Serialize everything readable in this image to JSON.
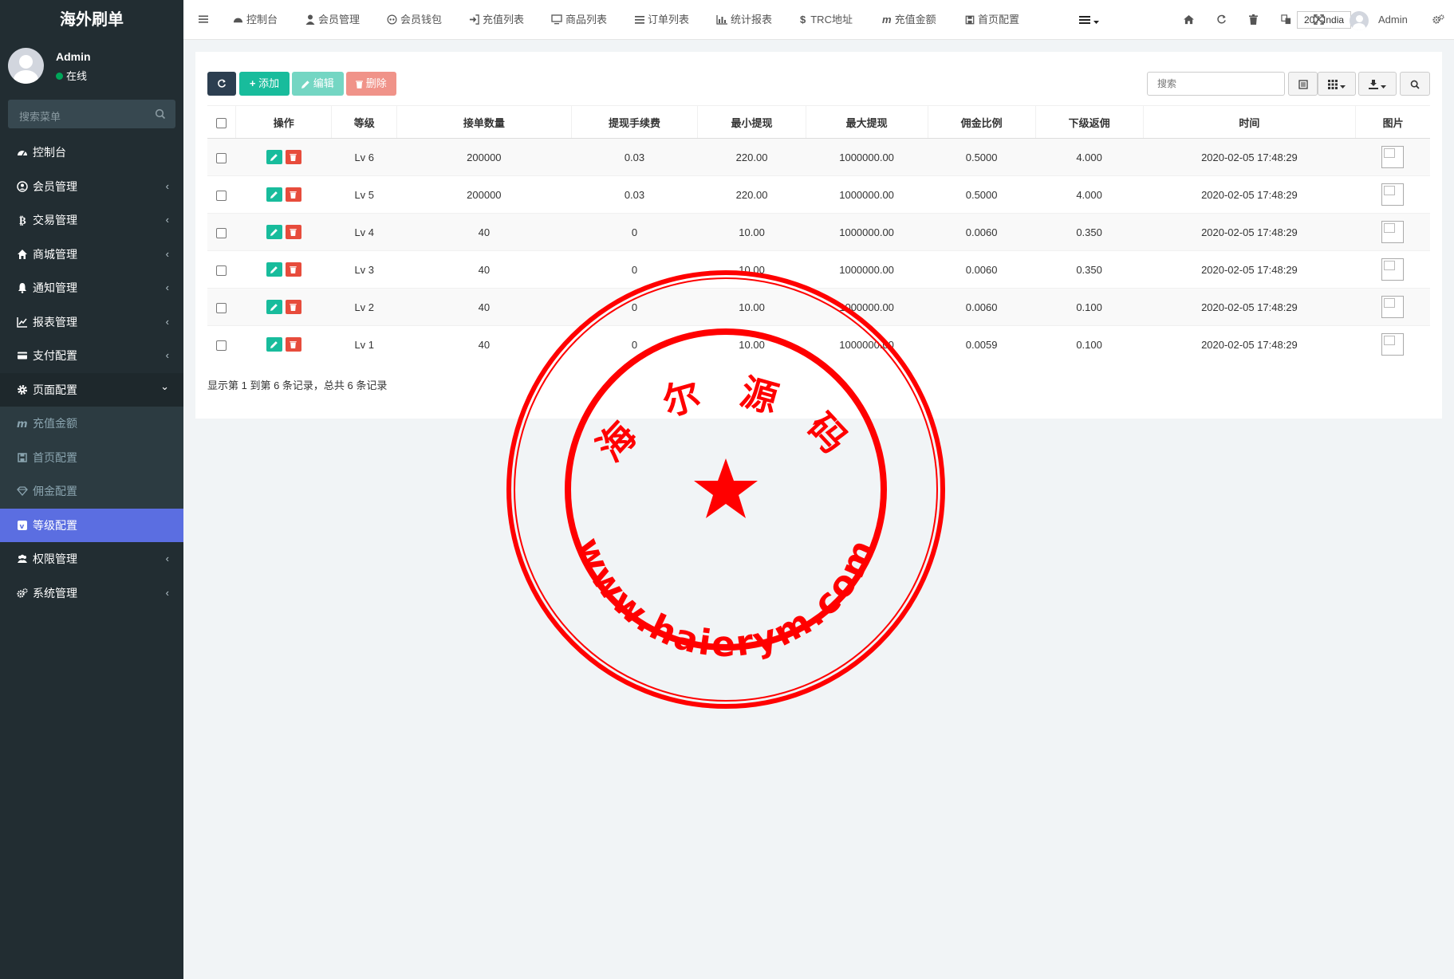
{
  "sidebar": {
    "logo": "海外刷单",
    "user": {
      "name": "Admin",
      "status": "在线"
    },
    "search_placeholder": "搜索菜单",
    "items": [
      {
        "label": "控制台",
        "icon": "dashboard-icon"
      },
      {
        "label": "会员管理",
        "icon": "user-circle-icon"
      },
      {
        "label": "交易管理",
        "icon": "bitcoin-icon"
      },
      {
        "label": "商城管理",
        "icon": "home-icon"
      },
      {
        "label": "通知管理",
        "icon": "bell-icon"
      },
      {
        "label": "报表管理",
        "icon": "line-chart-icon"
      },
      {
        "label": "支付配置",
        "icon": "credit-card-icon"
      },
      {
        "label": "页面配置",
        "icon": "gear-icon"
      }
    ],
    "subitems": [
      {
        "label": "充值金额",
        "icon": "m-icon"
      },
      {
        "label": "首页配置",
        "icon": "save-icon"
      },
      {
        "label": "佣金配置",
        "icon": "diamond-icon"
      },
      {
        "label": "等级配置",
        "icon": "vimeo-icon"
      }
    ],
    "items_after": [
      {
        "label": "权限管理",
        "icon": "users-icon"
      },
      {
        "label": "系统管理",
        "icon": "cogs-icon"
      }
    ],
    "chevron_left": "‹",
    "chevron_down": "⌄"
  },
  "topbar": {
    "nav": [
      "控制台",
      "会员管理",
      "会员钱包",
      "充值列表",
      "商品列表",
      "订单列表",
      "统计报表",
      "TRC地址",
      "充值金额",
      "首页配置"
    ],
    "region": "207-India",
    "admin": "Admin"
  },
  "toolbar": {
    "add_label": "添加",
    "edit_label": "编辑",
    "delete_label": "删除",
    "search_placeholder": "搜索"
  },
  "table": {
    "headers": [
      "操作",
      "等级",
      "接单数量",
      "提现手续费",
      "最小提现",
      "最大提现",
      "佣金比例",
      "下级返佣",
      "时间",
      "图片"
    ],
    "rows": [
      [
        "Lv 6",
        "200000",
        "0.03",
        "220.00",
        "1000000.00",
        "0.5000",
        "4.000",
        "2020-02-05 17:48:29"
      ],
      [
        "Lv 5",
        "200000",
        "0.03",
        "220.00",
        "1000000.00",
        "0.5000",
        "4.000",
        "2020-02-05 17:48:29"
      ],
      [
        "Lv 4",
        "40",
        "0",
        "10.00",
        "1000000.00",
        "0.0060",
        "0.350",
        "2020-02-05 17:48:29"
      ],
      [
        "Lv 3",
        "40",
        "0",
        "10.00",
        "1000000.00",
        "0.0060",
        "0.350",
        "2020-02-05 17:48:29"
      ],
      [
        "Lv 2",
        "40",
        "0",
        "10.00",
        "1000000.00",
        "0.0060",
        "0.100",
        "2020-02-05 17:48:29"
      ],
      [
        "Lv 1",
        "40",
        "0",
        "10.00",
        "1000000.00",
        "0.0059",
        "0.100",
        "2020-02-05 17:48:29"
      ]
    ]
  },
  "pager_text": "显示第 1 到第 6 条记录，总共 6 条记录",
  "watermark": {
    "top_text": "海 尔 源 码",
    "bottom_text": "www.haierym.com",
    "color": "#ff0000"
  },
  "colors": {
    "sidebar_bg": "#222d32",
    "active": "#5b6ee1",
    "success": "#18bc9c",
    "danger": "#e74c3c",
    "primary": "#2c3e50"
  }
}
